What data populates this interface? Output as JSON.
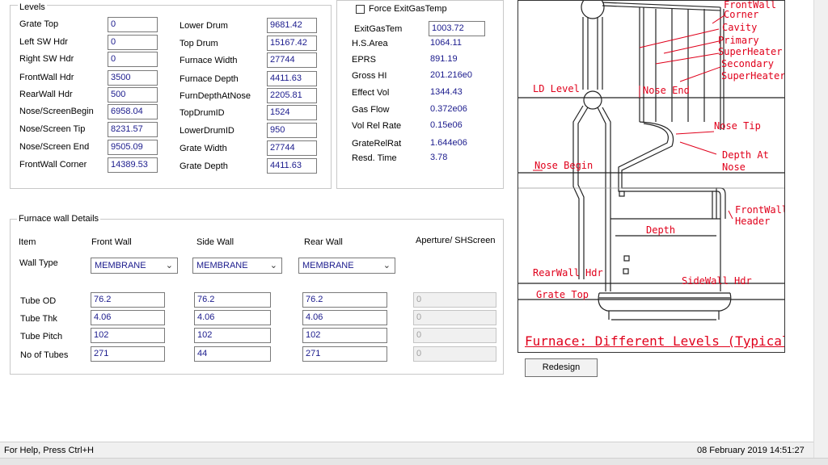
{
  "levels": {
    "title": "Levels",
    "left": [
      {
        "label": "Grate Top",
        "value": "0"
      },
      {
        "label": "Left SW Hdr",
        "value": "0"
      },
      {
        "label": "Right SW Hdr",
        "value": "0"
      },
      {
        "label": "FrontWall Hdr",
        "value": "3500"
      },
      {
        "label": "RearWall Hdr",
        "value": "500"
      },
      {
        "label": "Nose/ScreenBegin",
        "value": "6958.04"
      },
      {
        "label": "Nose/Screen Tip",
        "value": "8231.57"
      },
      {
        "label": "Nose/Screen End",
        "value": "9505.09"
      },
      {
        "label": "FrontWall Corner",
        "value": "14389.53"
      }
    ],
    "right": [
      {
        "label": "Lower Drum",
        "value": "9681.42"
      },
      {
        "label": "Top Drum",
        "value": "15167.42"
      },
      {
        "label": "Furnace Width",
        "value": "27744"
      },
      {
        "label": "Furnace Depth",
        "value": "4411.63"
      },
      {
        "label": "FurnDepthAtNose",
        "value": "2205.81"
      },
      {
        "label": "TopDrumID",
        "value": "1524"
      },
      {
        "label": "LowerDrumID",
        "value": "950"
      },
      {
        "label": "Grate Width",
        "value": "27744"
      },
      {
        "label": "Grate Depth",
        "value": "4411.63"
      }
    ]
  },
  "results": {
    "force_exit_label": "Force ExitGasTemp",
    "force_exit_checked": false,
    "exit_gas_label": "ExitGasTem",
    "exit_gas_value": "1003.72",
    "rows": [
      {
        "label": "H.S.Area",
        "value": "1064.11"
      },
      {
        "label": "EPRS",
        "value": "891.19"
      },
      {
        "label": "Gross HI",
        "value": "201.216e0"
      },
      {
        "label": "Effect Vol",
        "value": "1344.43"
      },
      {
        "label": "Gas Flow",
        "value": "0.372e06"
      },
      {
        "label": "Vol Rel Rate",
        "value": "0.15e06"
      },
      {
        "label": "GrateRelRat",
        "value": "1.644e06"
      },
      {
        "label": "Resd. Time",
        "value": "3.78"
      }
    ]
  },
  "wall": {
    "title": "Furnace wall Details",
    "headers": {
      "item": "Item",
      "front": "Front Wall",
      "side": "Side Wall",
      "rear": "Rear Wall",
      "aperture": "Aperture/ SHScreen"
    },
    "wall_type_label": "Wall Type",
    "wall_types": [
      "MEMBRANE",
      "MEMBRANE",
      "MEMBRANE"
    ],
    "rows": [
      {
        "label": "Tube OD",
        "values": [
          "76.2",
          "76.2",
          "76.2",
          "0"
        ]
      },
      {
        "label": "Tube Thk",
        "values": [
          "4.06",
          "4.06",
          "4.06",
          "0"
        ]
      },
      {
        "label": "Tube Pitch",
        "values": [
          "102",
          "102",
          "102",
          "0"
        ]
      },
      {
        "label": "No of Tubes",
        "values": [
          "271",
          "44",
          "271",
          "0"
        ]
      }
    ]
  },
  "diagram": {
    "labels": {
      "frontwall_corner": "FrontWall\nCorner",
      "cavity": "Cavity",
      "primary": "Primary\nSuperHeater",
      "secondary": "Secondary\nSuperHeater",
      "ld_level": "LD Level",
      "nose_end": "Nose End",
      "nose_tip": "Nose Tip",
      "depth_at_nose": "Depth At\nNose",
      "nose_begin": "Nose Begin",
      "frontwall_header": "FrontWall\nHeader",
      "depth": "Depth",
      "rearwall_hdr": "RearWall Hdr",
      "sidewall_hdr": "SideWall Hdr",
      "grate_top": "Grate Top"
    },
    "caption": "Furnace: Different Levels (Typical)"
  },
  "redesign_label": "Redesign",
  "status": {
    "help": "For Help, Press Ctrl+H",
    "datetime": "08 February 2019  14:51:27"
  }
}
